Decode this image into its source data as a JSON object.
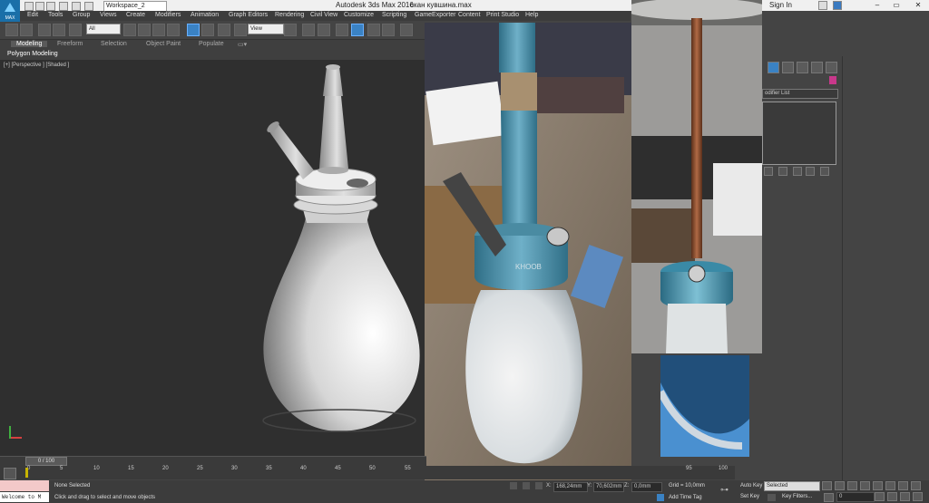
{
  "title_bar": {
    "app_title": "Autodesk 3ds Max 2016",
    "file_name": "скан кувшина.max",
    "workspace": "Workspace_2",
    "sign_in": "Sign In",
    "logo": "MAX"
  },
  "menu": [
    "Edit",
    "Tools",
    "Group",
    "Views",
    "Create",
    "Modifiers",
    "Animation",
    "Graph Editors",
    "Rendering",
    "Civil View",
    "Customize",
    "Scripting",
    "GameExporter",
    "Content",
    "Print Studio",
    "Help"
  ],
  "toolbar": {
    "selection_filter": "All",
    "ref_coord": "View"
  },
  "ribbon": {
    "tabs": [
      "Modeling",
      "Freeform",
      "Selection",
      "Object Paint",
      "Populate"
    ],
    "panel_title": "Polygon Modeling"
  },
  "viewport": {
    "label": "[+] [Perspective ] [Shaded ]"
  },
  "command_panel": {
    "modifier_list": "odifier List",
    "object_color": "#c8388b"
  },
  "timeline": {
    "slider": "0 / 100",
    "ticks": [
      "0",
      "5",
      "10",
      "15",
      "20",
      "25",
      "30",
      "35",
      "40",
      "45",
      "50",
      "55"
    ],
    "ticks_right": [
      "95",
      "100"
    ]
  },
  "status": {
    "maxscript": "Welcome to M",
    "selection": "None Selected",
    "prompt": "Click and drag to select and move objects",
    "x_label": "X:",
    "x_value": "168,24mm",
    "y_label": "Y:",
    "y_value": "70,602mm",
    "z_label": "Z:",
    "z_value": "0,0mm",
    "grid": "Grid = 10,0mm",
    "add_time_tag": "Add Time Tag",
    "auto_key": "Auto Key",
    "set_key": "Set Key",
    "selected_option": "Selected",
    "key_filters": "Key Filters...",
    "current_frame": "0"
  },
  "photo": {
    "brand_engraving": "KHOOB"
  }
}
